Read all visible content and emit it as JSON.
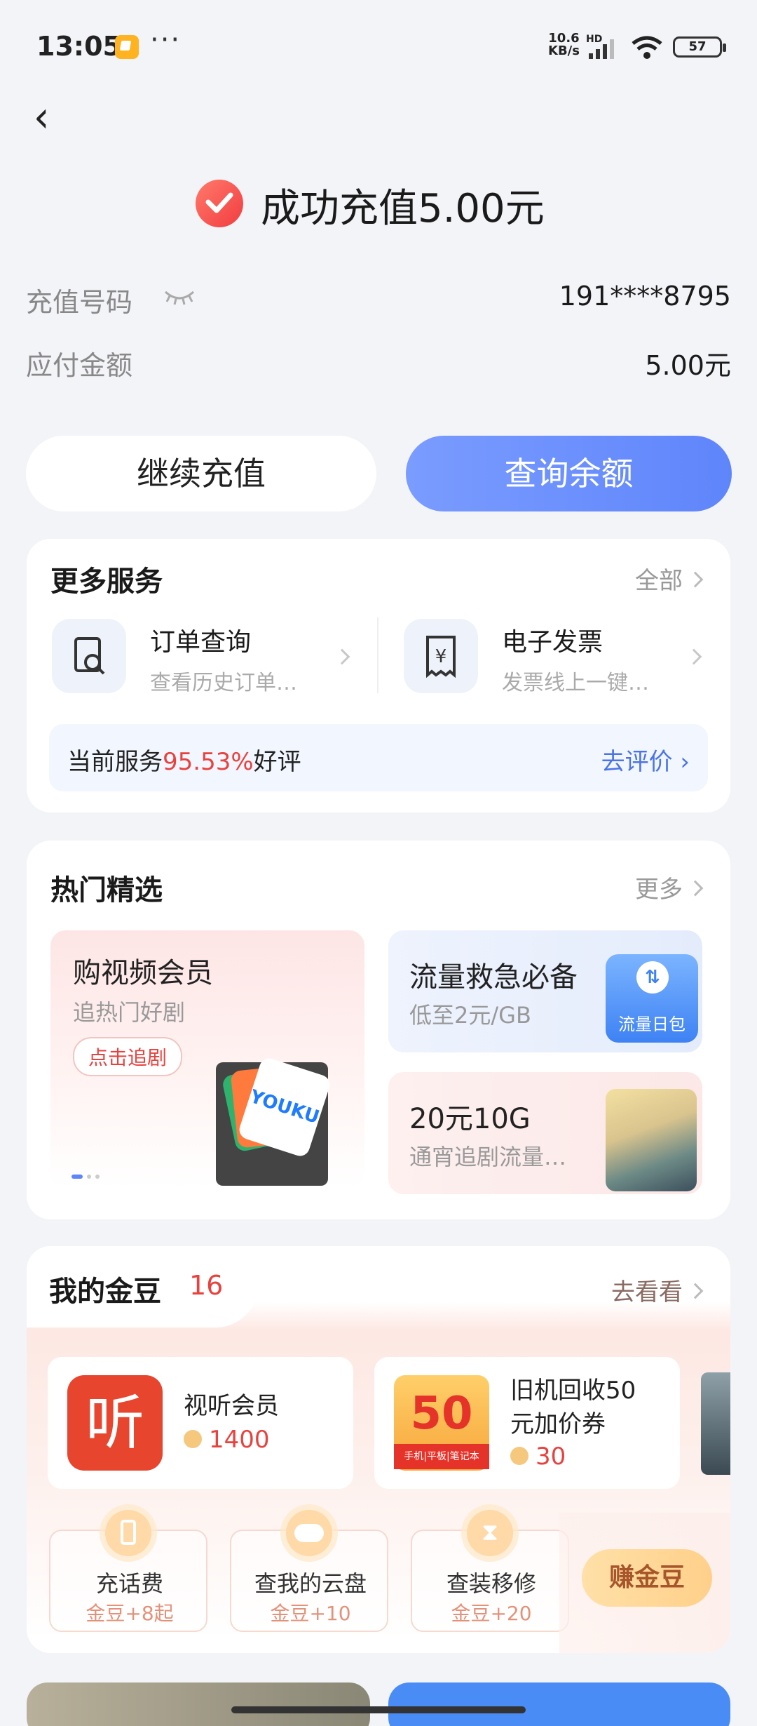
{
  "status_bar": {
    "time": "13:05",
    "net_speed": "10.6",
    "net_unit": "KB/s",
    "hd": "HD",
    "battery": "57"
  },
  "header": {
    "success_text": "成功充值5.00元"
  },
  "details": {
    "phone_label": "充值号码",
    "phone_value": "191****8795",
    "amount_label": "应付金额",
    "amount_value": "5.00元"
  },
  "actions": {
    "continue_label": "继续充值",
    "balance_label": "查询余额"
  },
  "services": {
    "title": "更多服务",
    "more": "全部",
    "items": [
      {
        "title": "订单查询",
        "subtitle": "查看历史订单…"
      },
      {
        "title": "电子发票",
        "subtitle": "发票线上一键…"
      }
    ],
    "rating_prefix": "当前服务",
    "rating_pct": "95.53%",
    "rating_suffix": "好评",
    "rating_action": "去评价"
  },
  "hot": {
    "title": "热门精选",
    "more": "更多",
    "big": {
      "title": "购视频会员",
      "subtitle": "追热门好剧",
      "tag": "点击追剧",
      "logo": "YOUKU"
    },
    "r1": {
      "title": "流量救急必备",
      "subtitle": "低至2元/GB",
      "badge": "流量日包"
    },
    "r2": {
      "title": "20元10G",
      "subtitle": "通宵追剧流量…"
    }
  },
  "gold": {
    "title": "我的金豆",
    "count": "16",
    "more": "去看看",
    "products": [
      {
        "title": "视听会员",
        "price": "1400",
        "logo": "听"
      },
      {
        "title_line1": "旧机回收50",
        "title_line2": "元加价券",
        "price": "30",
        "coupon": "50",
        "coupon_sub": "手机|平板|笔记本"
      }
    ],
    "tasks": [
      {
        "title": "充话费",
        "reward": "金豆+8起"
      },
      {
        "title": "查我的云盘",
        "reward": "金豆+10"
      },
      {
        "title": "查装移修",
        "reward": "金豆+20"
      }
    ],
    "earn_label": "赚金豆"
  },
  "colors": {
    "accent_blue": "#5f85fb",
    "success_red": "#f23c40",
    "highlight_red": "#e8423f"
  }
}
